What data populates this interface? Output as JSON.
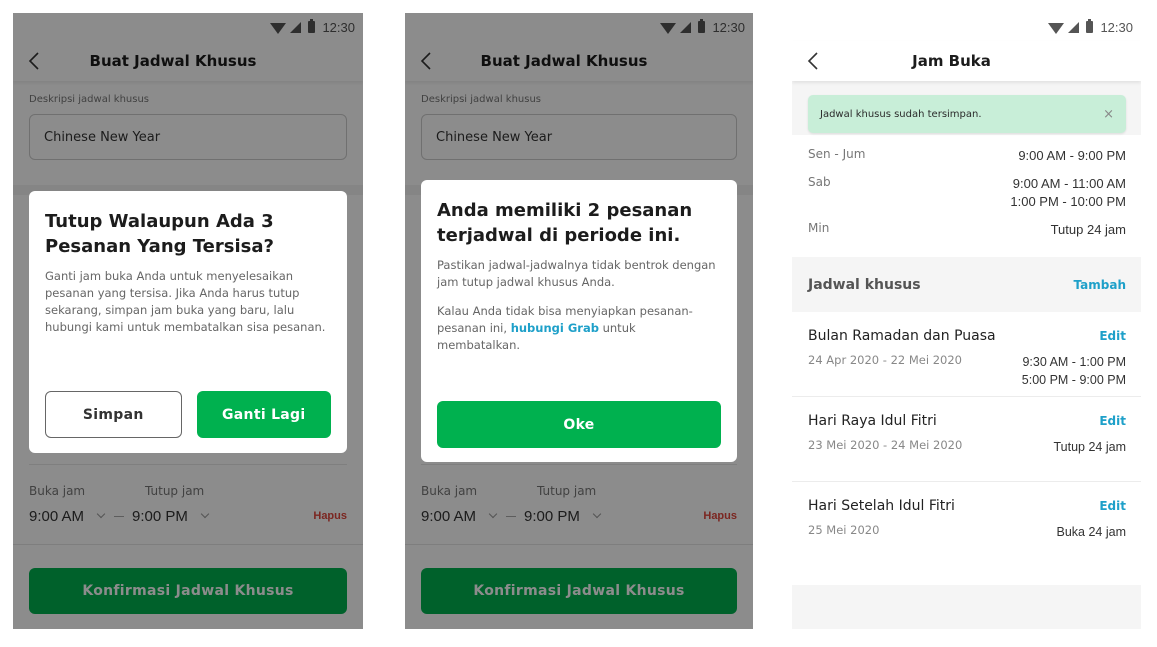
{
  "status_bar": {
    "time": "12:30"
  },
  "screens": [
    {
      "app_bar": {
        "title": "Buat Jadwal Khusus"
      },
      "form": {
        "description_label": "Deskripsi jadwal khusus",
        "description_value": "Chinese New Year",
        "open_label": "Buka jam",
        "close_label": "Tutup jam",
        "open_value": "9:00 AM",
        "close_value": "9:00 PM",
        "delete_label": "Hapus",
        "confirm_label": "Konfirmasi Jadwal Khusus"
      },
      "dialog": {
        "title": "Tutup Walaupun Ada 3 Pesanan Yang Tersisa?",
        "body": "Ganti jam buka Anda untuk menyelesaikan pesanan yang tersisa. Jika Anda harus tutup sekarang, simpan jam buka yang baru, lalu hubungi kami untuk membatalkan sisa pesanan.",
        "secondary_button": "Simpan",
        "primary_button": "Ganti Lagi"
      }
    },
    {
      "app_bar": {
        "title": "Buat Jadwal Khusus"
      },
      "form": {
        "description_label": "Deskripsi jadwal khusus",
        "description_value": "Chinese New Year",
        "open_label": "Buka jam",
        "close_label": "Tutup jam",
        "open_value": "9:00 AM",
        "close_value": "9:00 PM",
        "delete_label": "Hapus",
        "confirm_label": "Konfirmasi Jadwal Khusus"
      },
      "dialog": {
        "title": "Anda memiliki 2 pesanan terjadwal di periode ini.",
        "body1": "Pastikan jadwal-jadwalnya tidak bentrok dengan jam tutup jadwal khusus Anda.",
        "body2_prefix": "Kalau Anda tidak bisa menyiapkan pesanan-pesanan ini, ",
        "body2_link": "hubungi Grab",
        "body2_suffix": " untuk membatalkan.",
        "primary_button": "Oke"
      }
    },
    {
      "app_bar": {
        "title": "Jam Buka"
      },
      "alert": {
        "message": "Jadwal khusus sudah tersimpan.",
        "close_icon": "×"
      },
      "regular_hours": [
        {
          "day": "Sen - Jum",
          "hours": [
            "9:00 AM - 9:00 PM"
          ]
        },
        {
          "day": "Sab",
          "hours": [
            "9:00 AM - 11:00 AM",
            "1:00 PM - 10:00 PM"
          ]
        },
        {
          "day": "Min",
          "hours": [
            "Tutup 24 jam"
          ]
        }
      ],
      "special_section": {
        "title": "Jadwal khusus",
        "add_label": "Tambah"
      },
      "special_schedules": [
        {
          "name": "Bulan Ramadan dan Puasa",
          "dates": "24 Apr 2020 - 22 Mei 2020",
          "hours": [
            "9:30 AM - 1:00 PM",
            "5:00 PM - 9:00 PM"
          ],
          "edit_label": "Edit"
        },
        {
          "name": "Hari Raya Idul Fitri",
          "dates": "23 Mei 2020 - 24 Mei 2020",
          "hours": [
            "Tutup 24 jam"
          ],
          "edit_label": "Edit"
        },
        {
          "name": "Hari Setelah Idul Fitri",
          "dates": "25 Mei 2020",
          "hours": [
            "Buka 24 jam"
          ],
          "edit_label": "Edit"
        }
      ]
    }
  ],
  "colors": {
    "primary_green": "#00b14f",
    "link_blue": "#1ea0c9",
    "danger_red": "#e0463c",
    "success_alert_bg": "#c8eed8"
  }
}
